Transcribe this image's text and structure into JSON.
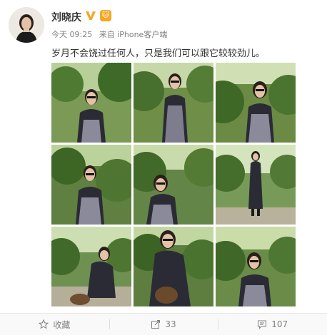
{
  "post": {
    "username": "刘晓庆",
    "verified_icon": "verified-v-icon",
    "level_badge": "🐱",
    "time": "今天 09:25",
    "source": "来自 iPhone客户端",
    "text": "岁月不会饶过任何人，只是我们可以跟它较较劲儿。",
    "photo_count": 9
  },
  "actions": {
    "favorite_label": "收藏",
    "repost_count": "33",
    "comment_count": "107"
  },
  "colors": {
    "accent": "#f5a623",
    "meta_text": "#808080"
  }
}
